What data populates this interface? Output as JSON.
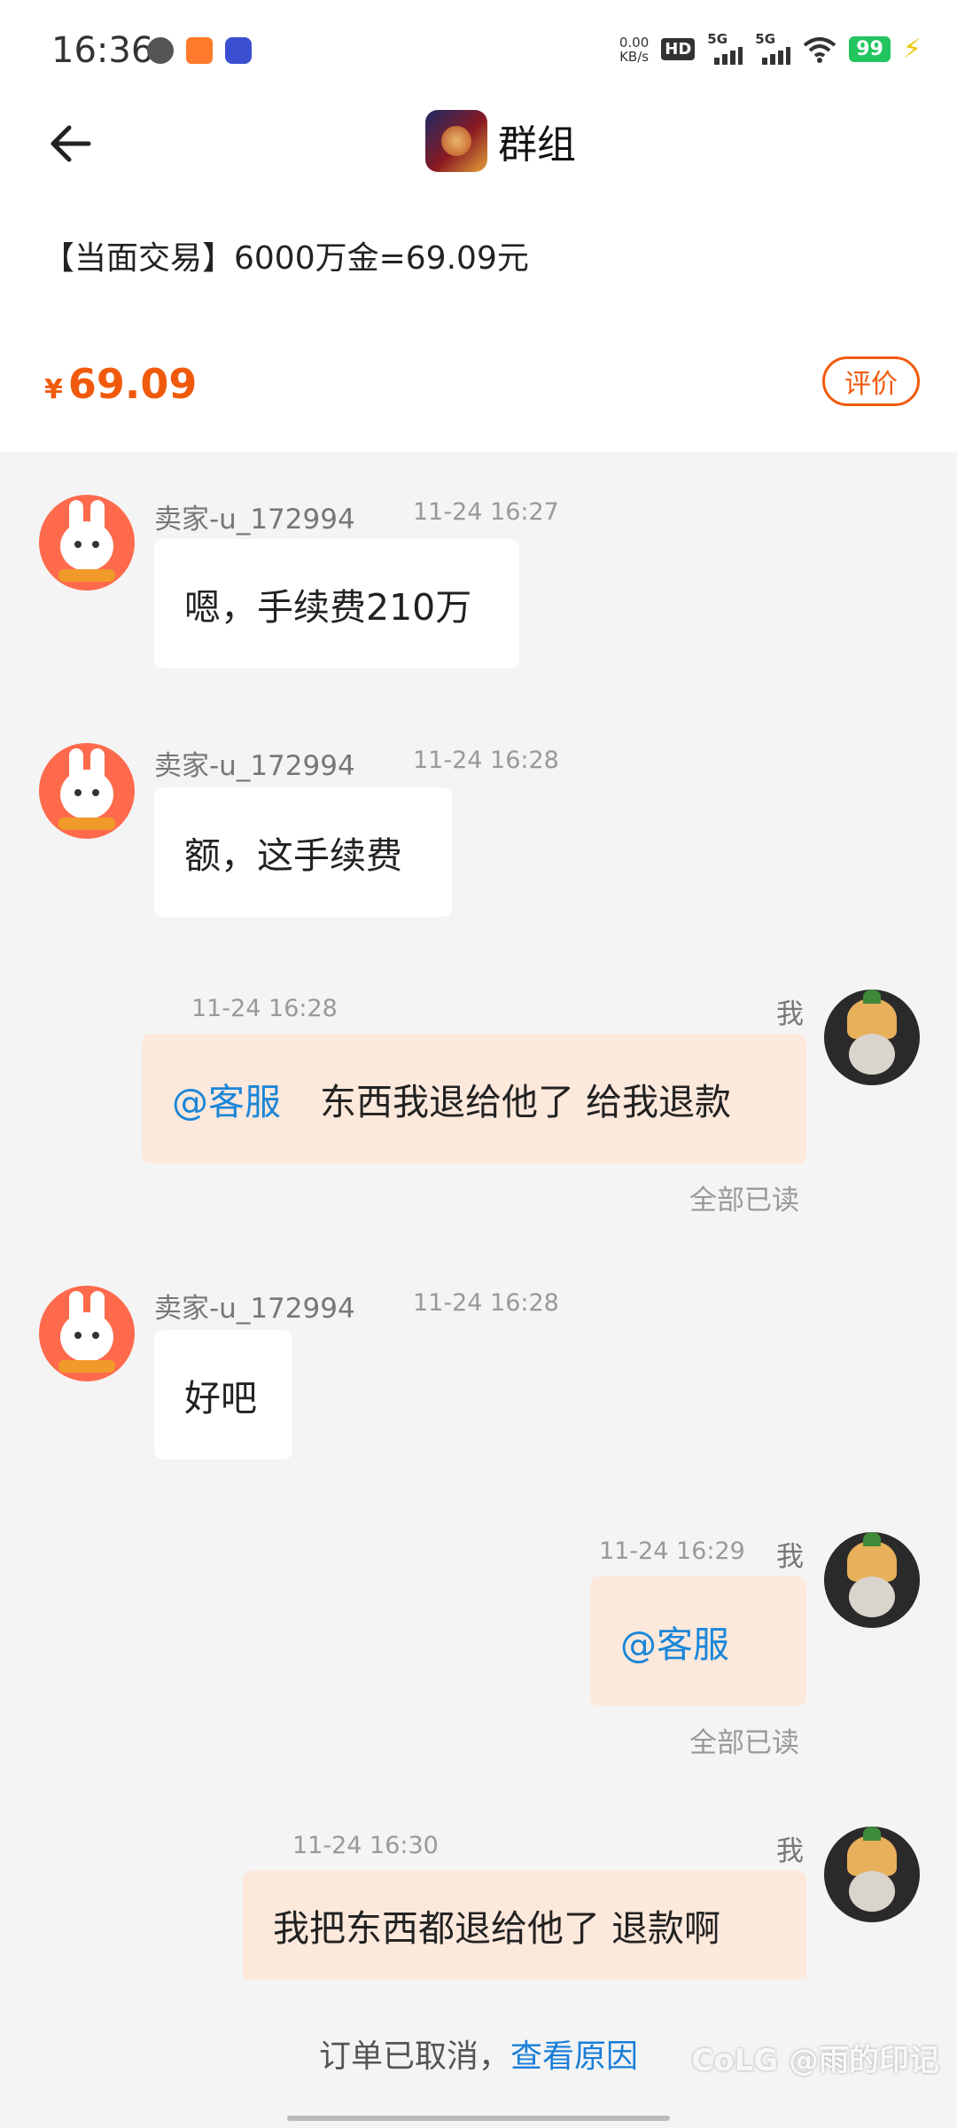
{
  "status_bar": {
    "time": "16:36",
    "net_speed_value": "0.00",
    "net_speed_unit": "KB/s",
    "hd_label": "HD",
    "sim1_label": "5G",
    "sim2_label": "5G",
    "battery": "99",
    "bolt": "⚡"
  },
  "header": {
    "title": "群组",
    "trade_title": "【当面交易】6000万金=69.09元",
    "price_symbol": "¥",
    "price": "69.09",
    "review_label": "评价"
  },
  "messages": [
    {
      "sender": "卖家-u_172994",
      "time": "11-24 16:27",
      "text": "嗯，手续费210万"
    },
    {
      "sender": "卖家-u_172994",
      "time": "11-24 16:28",
      "text": "额，这手续费"
    },
    {
      "sender": "我",
      "time": "11-24 16:28",
      "mention": "@客服",
      "text": "东西我退给他了 给我退款",
      "read": "全部已读"
    },
    {
      "sender": "卖家-u_172994",
      "time": "11-24 16:28",
      "text": "好吧"
    },
    {
      "sender": "我",
      "time": "11-24 16:29",
      "mention": "@客服",
      "text": "",
      "read": "全部已读"
    },
    {
      "sender": "我",
      "time": "11-24 16:30",
      "text": "我把东西都退给他了  退款啊"
    }
  ],
  "footer": {
    "notice": "订单已取消，",
    "link": "查看原因",
    "watermark": "CoLG @雨的印记"
  }
}
